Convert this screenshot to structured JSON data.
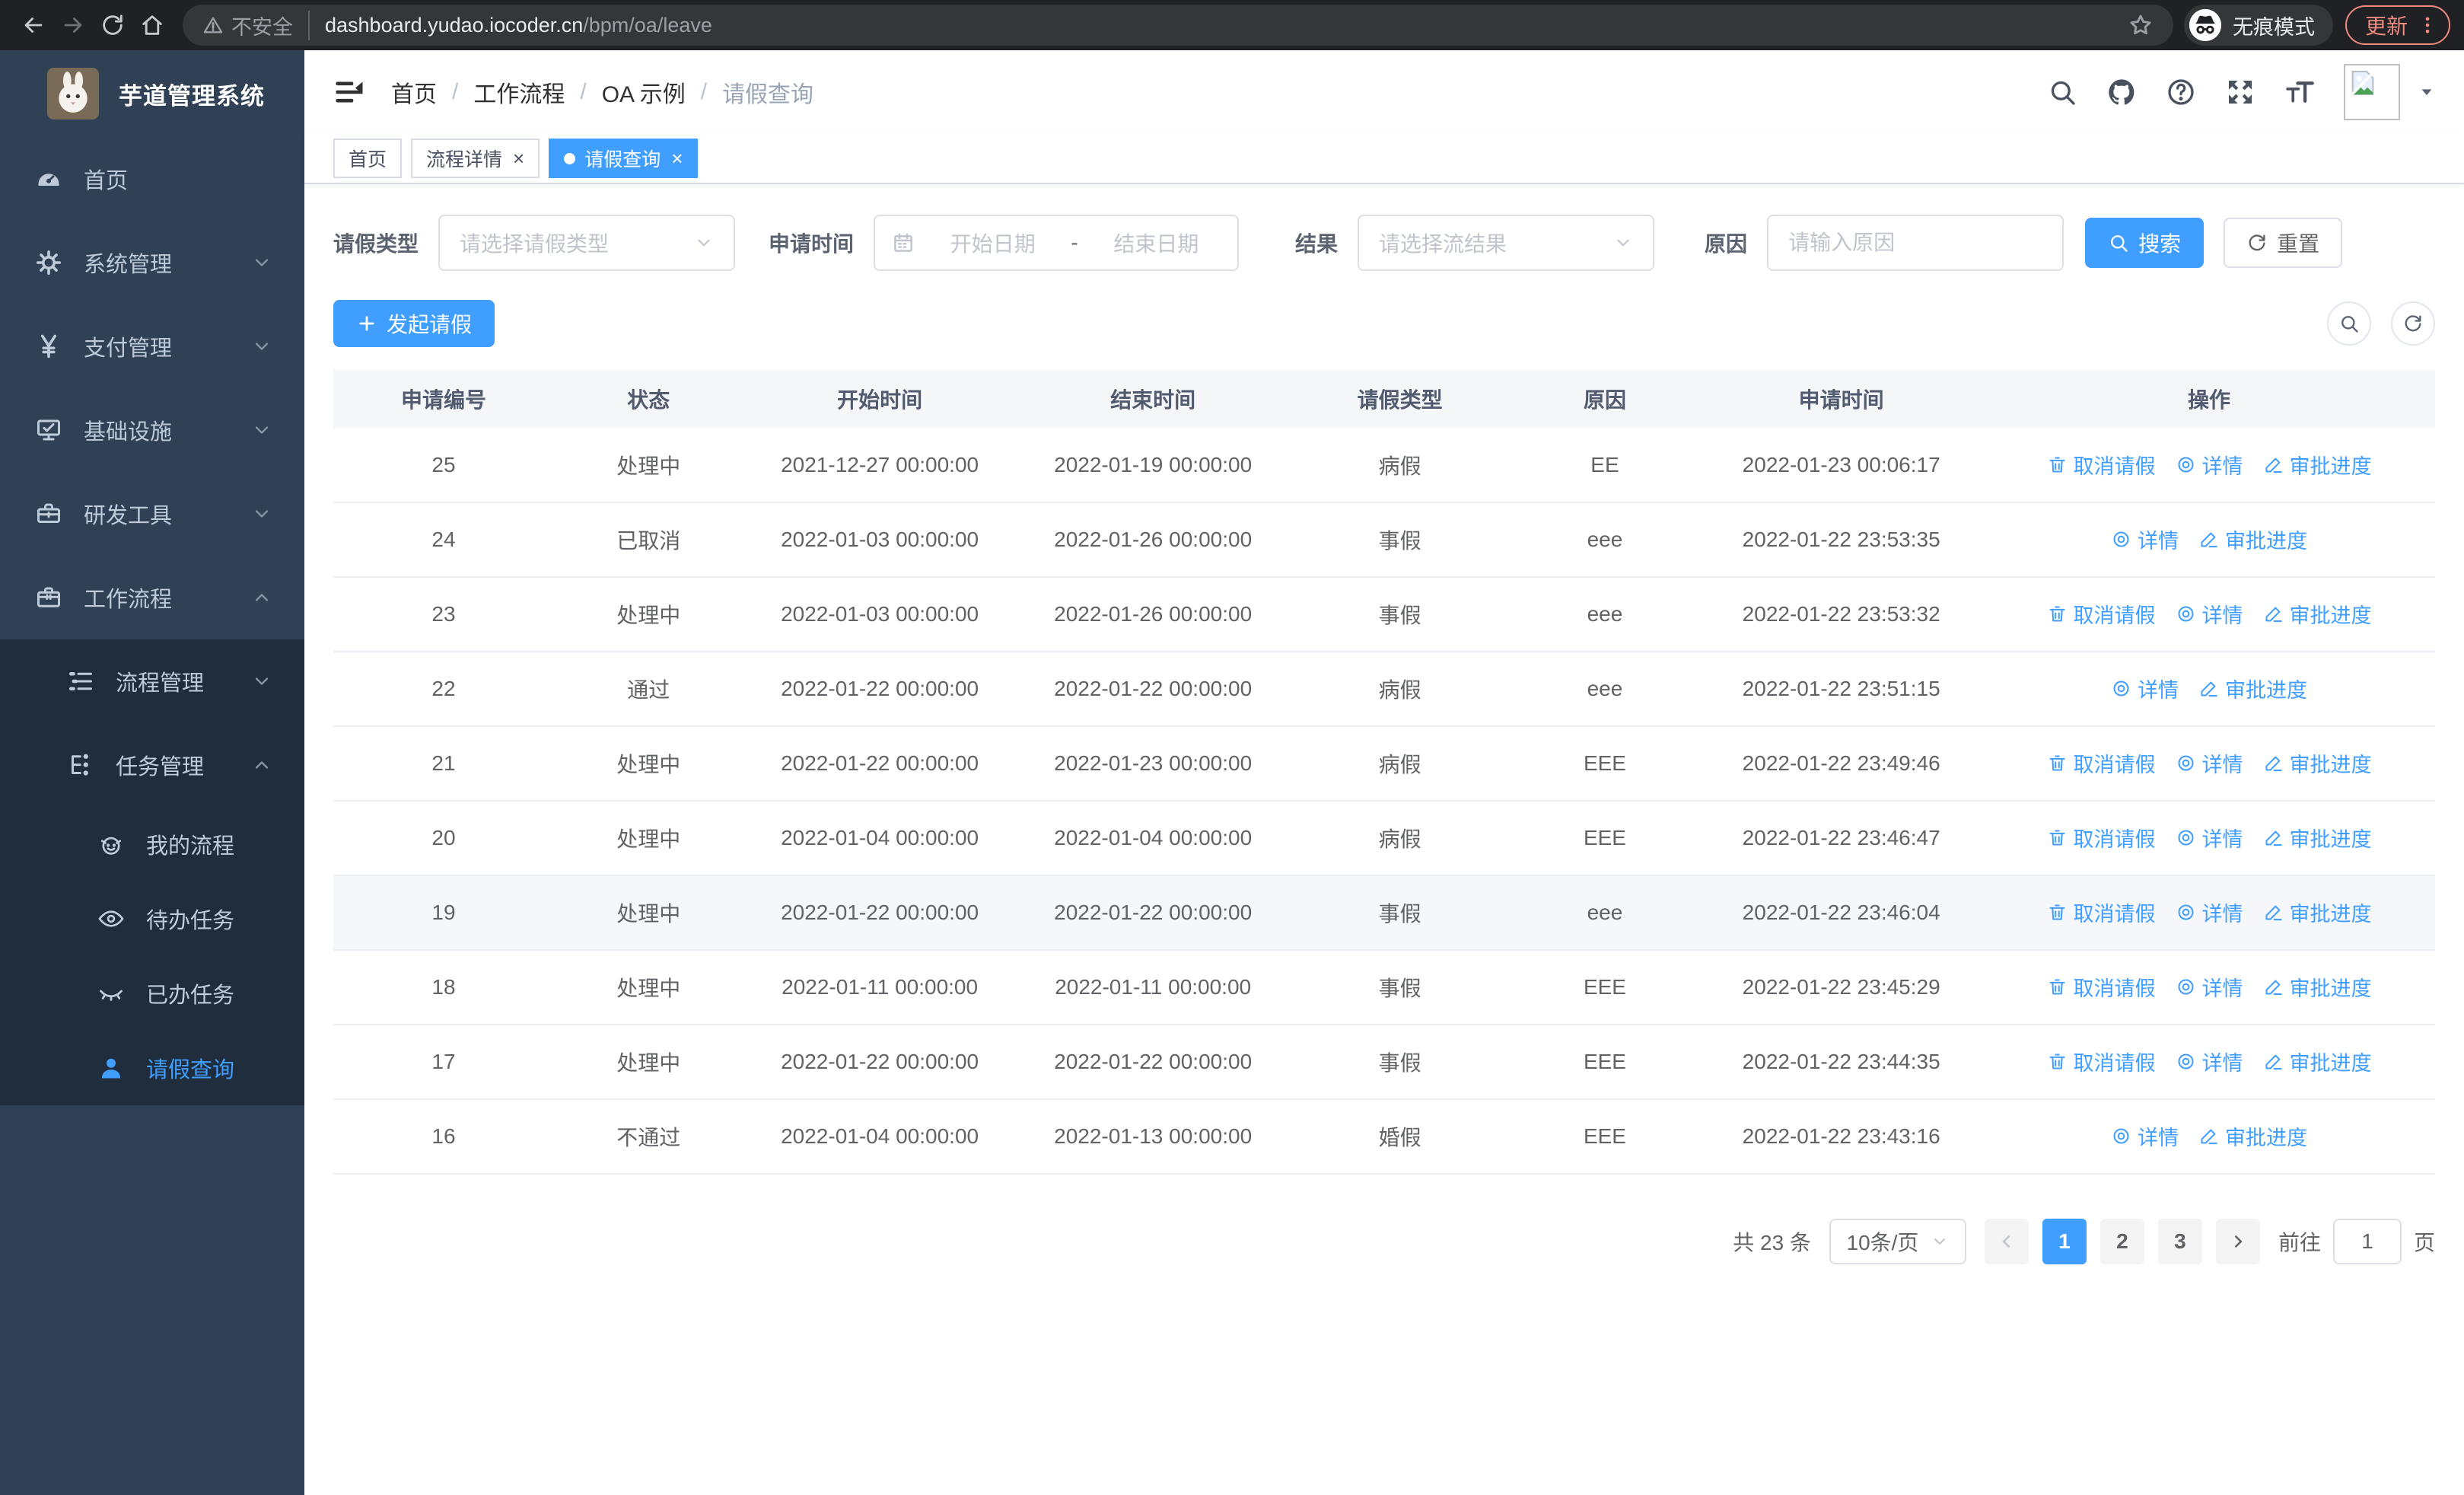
{
  "browser": {
    "security_label": "不安全",
    "url_host": "dashboard.yudao.iocoder.cn",
    "url_path": "/bpm/oa/leave",
    "incognito_label": "无痕模式",
    "update_label": "更新"
  },
  "sidebar": {
    "app_title": "芋道管理系统",
    "menu": [
      {
        "label": "首页",
        "icon": "dashboard-icon",
        "level": 1
      },
      {
        "label": "系统管理",
        "icon": "gear-icon",
        "level": 1,
        "chevron": "down"
      },
      {
        "label": "支付管理",
        "icon": "yen-icon",
        "level": 1,
        "chevron": "down"
      },
      {
        "label": "基础设施",
        "icon": "monitor-icon",
        "level": 1,
        "chevron": "down"
      },
      {
        "label": "研发工具",
        "icon": "toolbox-icon",
        "level": 1,
        "chevron": "down"
      },
      {
        "label": "工作流程",
        "icon": "briefcase-icon",
        "level": 1,
        "chevron": "up"
      },
      {
        "label": "流程管理",
        "icon": "process-icon",
        "level": 2,
        "chevron": "down"
      },
      {
        "label": "任务管理",
        "icon": "tasks-icon",
        "level": 2,
        "chevron": "up"
      },
      {
        "label": "我的流程",
        "icon": "face-icon",
        "level": 3
      },
      {
        "label": "待办任务",
        "icon": "eye-icon",
        "level": 3
      },
      {
        "label": "已办任务",
        "icon": "eye-closed-icon",
        "level": 3
      },
      {
        "label": "请假查询",
        "icon": "user-icon",
        "level": 3,
        "active": true
      }
    ]
  },
  "header": {
    "breadcrumb": [
      "首页",
      "工作流程",
      "OA 示例",
      "请假查询"
    ]
  },
  "tabs": [
    {
      "label": "首页",
      "closable": false,
      "active": false
    },
    {
      "label": "流程详情",
      "closable": true,
      "active": false
    },
    {
      "label": "请假查询",
      "closable": true,
      "active": true
    }
  ],
  "filters": {
    "leave_type_label": "请假类型",
    "leave_type_placeholder": "请选择请假类型",
    "apply_time_label": "申请时间",
    "start_date_placeholder": "开始日期",
    "date_separator": "-",
    "end_date_placeholder": "结束日期",
    "result_label": "结果",
    "result_placeholder": "请选择流结果",
    "reason_label": "原因",
    "reason_placeholder": "请输入原因",
    "search_label": "搜索",
    "reset_label": "重置"
  },
  "toolbar": {
    "create_label": "发起请假"
  },
  "table": {
    "columns": [
      "申请编号",
      "状态",
      "开始时间",
      "结束时间",
      "请假类型",
      "原因",
      "申请时间",
      "操作"
    ],
    "actions": {
      "cancel": "取消请假",
      "detail": "详情",
      "progress": "审批进度"
    },
    "rows": [
      {
        "id": "25",
        "status": "处理中",
        "start": "2021-12-27 00:00:00",
        "end": "2022-01-19 00:00:00",
        "type": "病假",
        "reason": "EE",
        "applied": "2022-01-23 00:06:17",
        "cancelable": true,
        "highlight": false
      },
      {
        "id": "24",
        "status": "已取消",
        "start": "2022-01-03 00:00:00",
        "end": "2022-01-26 00:00:00",
        "type": "事假",
        "reason": "eee",
        "applied": "2022-01-22 23:53:35",
        "cancelable": false,
        "highlight": false
      },
      {
        "id": "23",
        "status": "处理中",
        "start": "2022-01-03 00:00:00",
        "end": "2022-01-26 00:00:00",
        "type": "事假",
        "reason": "eee",
        "applied": "2022-01-22 23:53:32",
        "cancelable": true,
        "highlight": false
      },
      {
        "id": "22",
        "status": "通过",
        "start": "2022-01-22 00:00:00",
        "end": "2022-01-22 00:00:00",
        "type": "病假",
        "reason": "eee",
        "applied": "2022-01-22 23:51:15",
        "cancelable": false,
        "highlight": false
      },
      {
        "id": "21",
        "status": "处理中",
        "start": "2022-01-22 00:00:00",
        "end": "2022-01-23 00:00:00",
        "type": "病假",
        "reason": "EEE",
        "applied": "2022-01-22 23:49:46",
        "cancelable": true,
        "highlight": false
      },
      {
        "id": "20",
        "status": "处理中",
        "start": "2022-01-04 00:00:00",
        "end": "2022-01-04 00:00:00",
        "type": "病假",
        "reason": "EEE",
        "applied": "2022-01-22 23:46:47",
        "cancelable": true,
        "highlight": false
      },
      {
        "id": "19",
        "status": "处理中",
        "start": "2022-01-22 00:00:00",
        "end": "2022-01-22 00:00:00",
        "type": "事假",
        "reason": "eee",
        "applied": "2022-01-22 23:46:04",
        "cancelable": true,
        "highlight": true
      },
      {
        "id": "18",
        "status": "处理中",
        "start": "2022-01-11 00:00:00",
        "end": "2022-01-11 00:00:00",
        "type": "事假",
        "reason": "EEE",
        "applied": "2022-01-22 23:45:29",
        "cancelable": true,
        "highlight": false
      },
      {
        "id": "17",
        "status": "处理中",
        "start": "2022-01-22 00:00:00",
        "end": "2022-01-22 00:00:00",
        "type": "事假",
        "reason": "EEE",
        "applied": "2022-01-22 23:44:35",
        "cancelable": true,
        "highlight": false
      },
      {
        "id": "16",
        "status": "不通过",
        "start": "2022-01-04 00:00:00",
        "end": "2022-01-13 00:00:00",
        "type": "婚假",
        "reason": "EEE",
        "applied": "2022-01-22 23:43:16",
        "cancelable": false,
        "highlight": false
      }
    ]
  },
  "pagination": {
    "total_label": "共 23 条",
    "page_size": "10条/页",
    "pages": [
      "1",
      "2",
      "3"
    ],
    "active_page": "1",
    "goto_label": "前往",
    "goto_value": "1",
    "page_suffix": "页"
  },
  "colors": {
    "accent": "#409eff",
    "sidebar_bg": "#304156",
    "submenu_bg": "#1f2d3d",
    "sidebar_text": "#bfcbd9",
    "update_pill": "#ee8a80"
  }
}
